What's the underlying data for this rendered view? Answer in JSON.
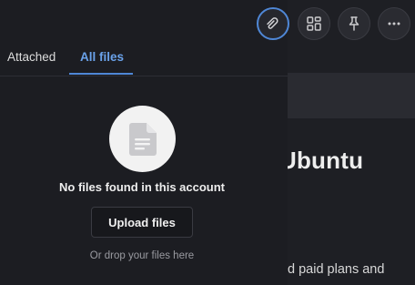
{
  "toolbar": {
    "buttons": [
      {
        "icon": "paperclip-icon",
        "active": true
      },
      {
        "icon": "layout-grid-icon",
        "active": false
      },
      {
        "icon": "pin-icon",
        "active": false
      },
      {
        "icon": "more-horizontal-icon",
        "active": false
      }
    ]
  },
  "tabs": [
    {
      "label": "Attached",
      "active": false
    },
    {
      "label": "All files",
      "active": true
    }
  ],
  "empty_state": {
    "icon": "file-document-icon",
    "title": "No files found in this account",
    "upload_label": "Upload files",
    "hint": "Or drop your files here"
  },
  "background_page": {
    "heading": "Ubuntu",
    "text_line1": "d paid plans and"
  },
  "colors": {
    "accent": "#4f87d6",
    "panel_bg": "#1c1d22"
  }
}
